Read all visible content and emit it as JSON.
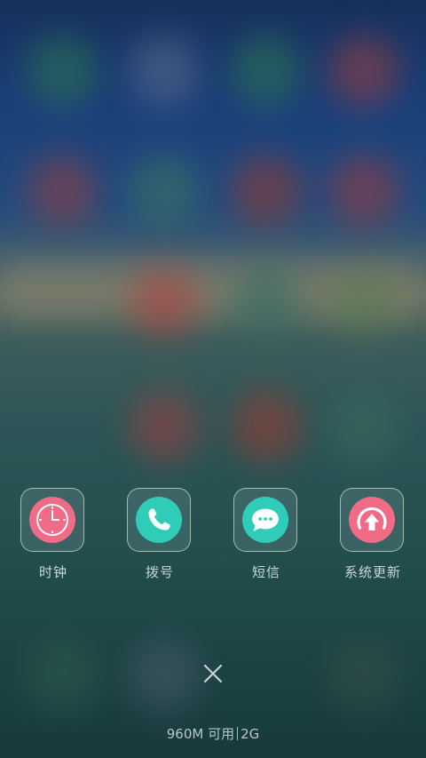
{
  "apps": [
    {
      "label": "时钟",
      "icon": "clock-icon",
      "color": "#f06b86"
    },
    {
      "label": "拨号",
      "icon": "phone-icon",
      "color": "#2fcdb8"
    },
    {
      "label": "短信",
      "icon": "message-icon",
      "color": "#2fcdb8"
    },
    {
      "label": "系统更新",
      "icon": "system-update-icon",
      "color": "#f06b86"
    }
  ],
  "close": {
    "icon": "close-icon"
  },
  "memory": {
    "available": "960M 可用",
    "total": "2G"
  }
}
